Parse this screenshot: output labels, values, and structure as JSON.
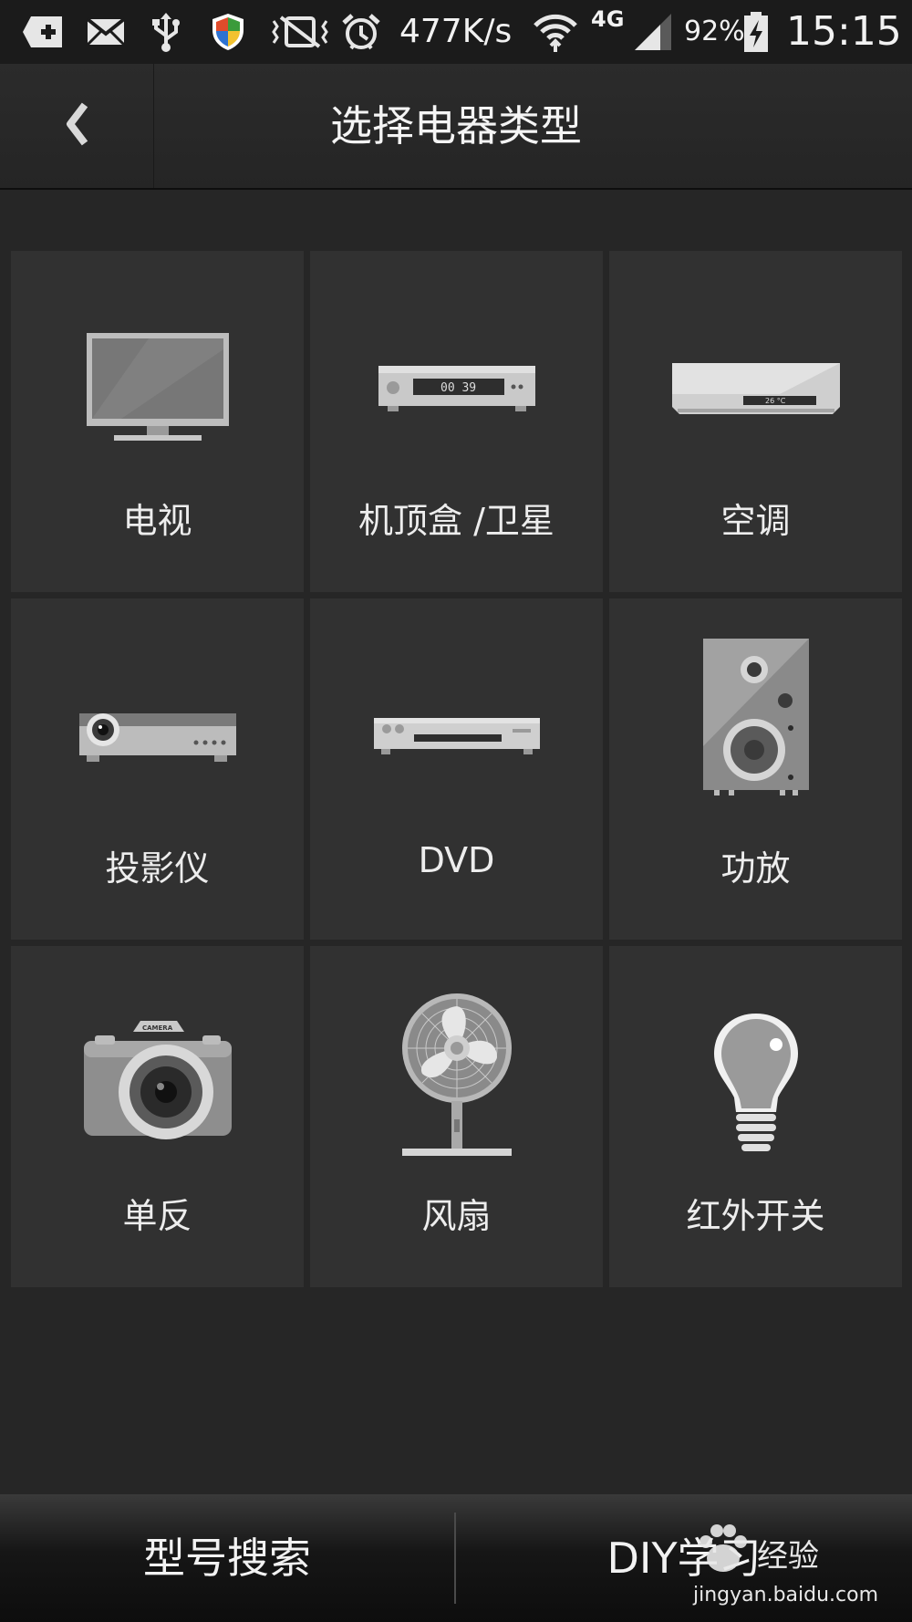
{
  "status_bar": {
    "network_speed": "477K/s",
    "network_type": "4G",
    "battery": "92%",
    "time": "15:15",
    "icons": [
      "add-icon",
      "mail-icon",
      "usb-icon",
      "shield-icon",
      "vibrate-off-icon",
      "alarm-icon",
      "wifi-icon",
      "signal-icon",
      "battery-charging-icon"
    ]
  },
  "header": {
    "back_icon": "chevron-left-icon",
    "title": "选择电器类型"
  },
  "devices": [
    {
      "label": "电视",
      "icon": "tv-icon"
    },
    {
      "label": "机顶盒 /卫星",
      "icon": "set-top-box-icon"
    },
    {
      "label": "空调",
      "icon": "air-conditioner-icon"
    },
    {
      "label": "投影仪",
      "icon": "projector-icon"
    },
    {
      "label": "DVD",
      "icon": "dvd-player-icon"
    },
    {
      "label": "功放",
      "icon": "speaker-icon"
    },
    {
      "label": "单反",
      "icon": "camera-icon"
    },
    {
      "label": "风扇",
      "icon": "fan-icon"
    },
    {
      "label": "红外开关",
      "icon": "light-bulb-icon"
    }
  ],
  "icon_text": {
    "stb_display": "00 39",
    "ac_display": "26 °C",
    "camera_brand": "CAMERA"
  },
  "bottom_bar": {
    "search_label": "型号搜索",
    "diy_label": "DIY学习"
  },
  "watermark": {
    "brand": "经验",
    "url": "jingyan.baidu.com"
  },
  "colors": {
    "background": "#262626",
    "tile": "#313131",
    "status_bar": "#1b1b1b"
  }
}
